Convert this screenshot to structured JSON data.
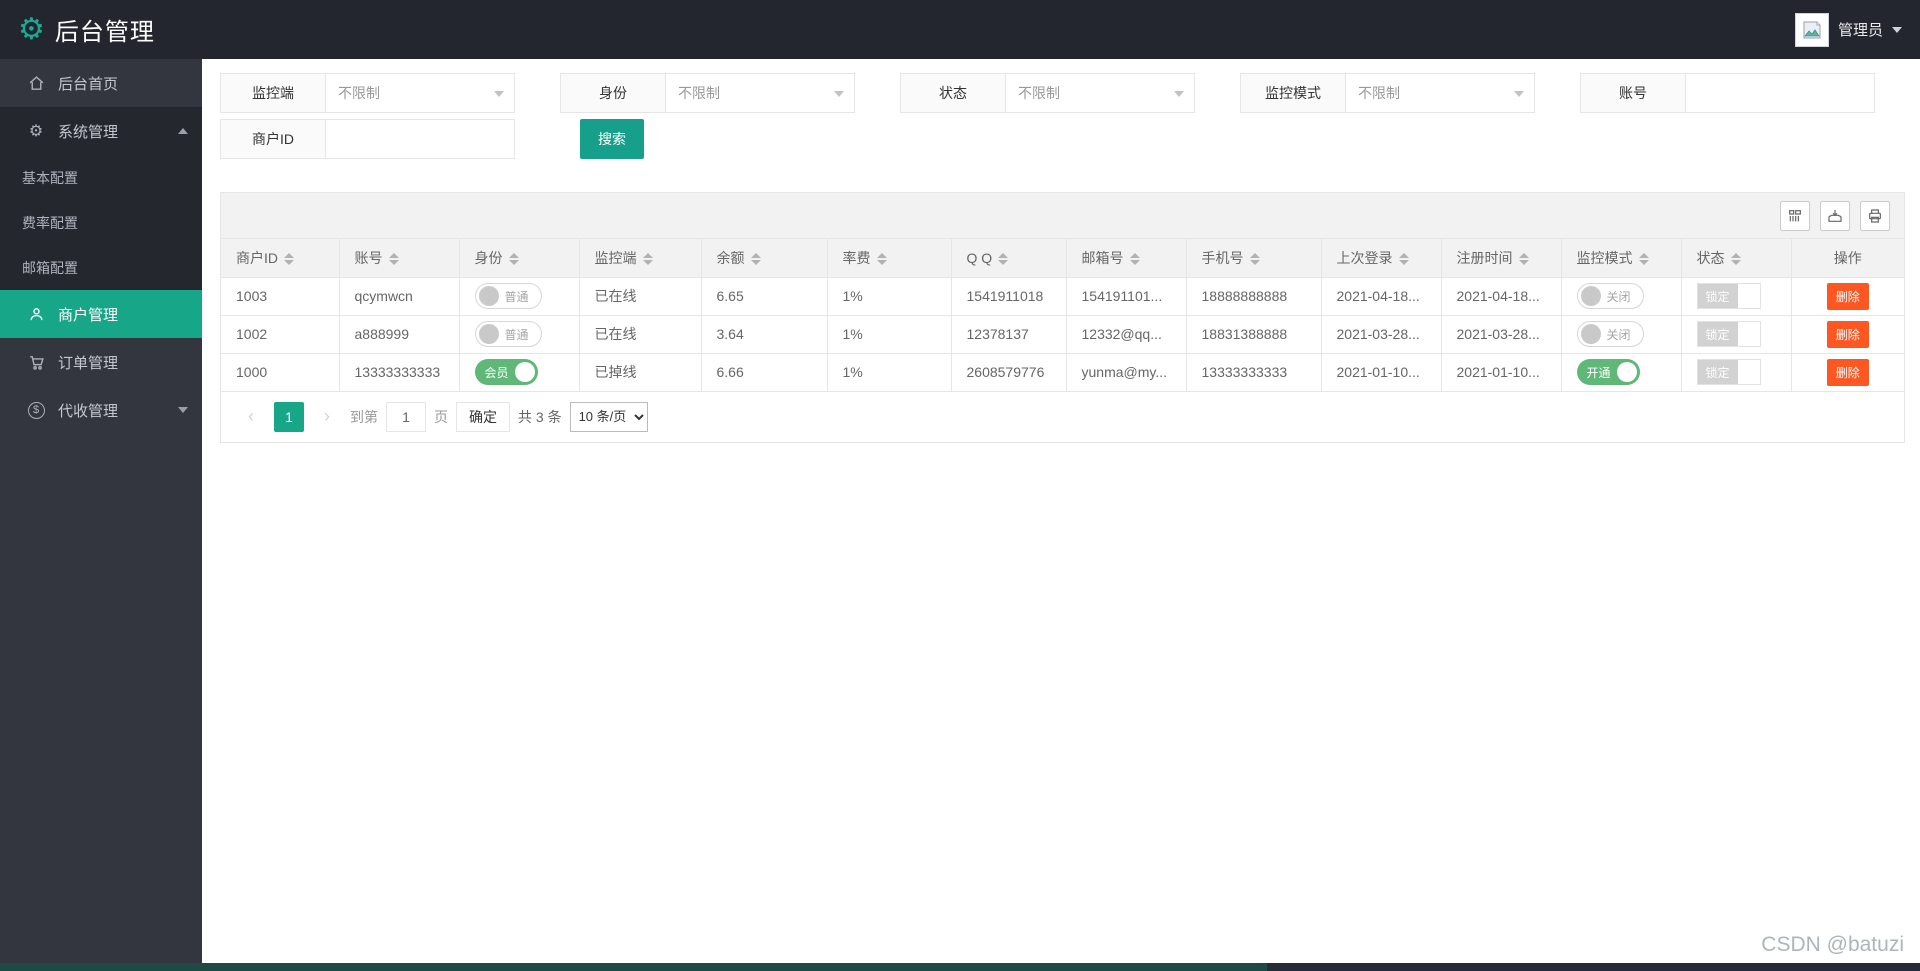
{
  "topbar": {
    "title": "后台管理",
    "user_name": "管理员"
  },
  "sidebar": {
    "items": [
      {
        "label": "后台首页"
      },
      {
        "label": "系统管理"
      },
      {
        "label": "基本配置"
      },
      {
        "label": "费率配置"
      },
      {
        "label": "邮箱配置"
      },
      {
        "label": "商户管理"
      },
      {
        "label": "订单管理"
      },
      {
        "label": "代收管理"
      }
    ]
  },
  "filters": {
    "monitor_client_label": "监控端",
    "identity_label": "身份",
    "status_label": "状态",
    "monitor_mode_label": "监控模式",
    "account_label": "账号",
    "merchant_id_label": "商户ID",
    "unrestricted": "不限制",
    "account_value": "",
    "merchant_id_value": "",
    "search_button": "搜索"
  },
  "toolbar": {
    "icons": [
      "filter-columns",
      "export",
      "print"
    ]
  },
  "table": {
    "columns": [
      "商户ID",
      "账号",
      "身份",
      "监控端",
      "余额",
      "率费",
      "Q Q",
      "邮箱号",
      "手机号",
      "上次登录",
      "注册时间",
      "监控模式",
      "状态",
      "操作"
    ],
    "rows": [
      {
        "merchant_id": "1003",
        "account": "qcymwcn",
        "identity": "普通",
        "monitor_client": "已在线",
        "balance": "6.65",
        "rate": "1%",
        "qq": "1541911018",
        "email": "154191101...",
        "phone": "18888888888",
        "last_login": "2021-04-18...",
        "register_time": "2021-04-18...",
        "monitor_mode": "关闭",
        "status": "锁定",
        "action": "删除"
      },
      {
        "merchant_id": "1002",
        "account": "a888999",
        "identity": "普通",
        "monitor_client": "已在线",
        "balance": "3.64",
        "rate": "1%",
        "qq": "12378137",
        "email": "12332@qq...",
        "phone": "18831388888",
        "last_login": "2021-03-28...",
        "register_time": "2021-03-28...",
        "monitor_mode": "关闭",
        "status": "锁定",
        "action": "删除"
      },
      {
        "merchant_id": "1000",
        "account": "13333333333",
        "identity": "会员",
        "monitor_client": "已掉线",
        "balance": "6.66",
        "rate": "1%",
        "qq": "2608579776",
        "email": "yunma@my...",
        "phone": "13333333333",
        "last_login": "2021-01-10...",
        "register_time": "2021-01-10...",
        "monitor_mode": "开通",
        "status": "锁定",
        "action": "删除"
      }
    ]
  },
  "pagination": {
    "current_page": "1",
    "goto_label": "到第",
    "goto_value": "1",
    "page_label": "页",
    "confirm_button": "确定",
    "total_text": "共 3 条",
    "page_size_option": "10 条/页"
  },
  "watermark": "CSDN @batuzi",
  "colors": {
    "accent": "#18A689",
    "switch_on": "#5FB878",
    "danger": "#FF5722",
    "topbar": "#23262E",
    "sidebar": "#33363F"
  }
}
